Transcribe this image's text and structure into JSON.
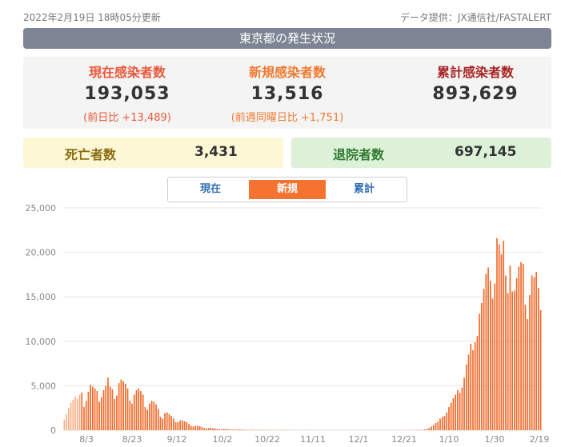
{
  "header": {
    "updated": "2022年2月19日 18時05分更新",
    "source": "データ提供：JX通信社/FASTALERT"
  },
  "title": "東京都の発生状況",
  "stats": {
    "current": {
      "label": "現在感染者数",
      "value": "193,053",
      "sub": "(前日比 +13,489)"
    },
    "new": {
      "label": "新規感染者数",
      "value": "13,516",
      "sub": "(前週同曜日比 +1,751)"
    },
    "total": {
      "label": "累計感染者数",
      "value": "893,629"
    },
    "deaths": {
      "label": "死亡者数",
      "value": "3,431"
    },
    "recovered": {
      "label": "退院者数",
      "value": "697,145"
    }
  },
  "tabs": [
    {
      "label": "現在",
      "active": false
    },
    {
      "label": "新規",
      "active": true
    },
    {
      "label": "累計",
      "active": false
    }
  ],
  "colors": {
    "bar": "#f06a2a",
    "bar_light": "#f7b08a",
    "title_bg": "#7d8493",
    "active_tab": "#f47330"
  },
  "chart_data": {
    "type": "bar",
    "ylim": [
      0,
      25000
    ],
    "yticks": [
      "0",
      "5,000",
      "10,000",
      "15,000",
      "20,000",
      "25,000"
    ],
    "xticks": [
      "8/3",
      "8/23",
      "9/12",
      "10/2",
      "10/22",
      "11/11",
      "12/1",
      "12/21",
      "1/10",
      "1/30",
      "2/19"
    ],
    "series": [
      {
        "values": [
          1200,
          1800,
          2500,
          3100,
          3400,
          3800,
          3500,
          4000,
          4200,
          2600,
          3300,
          4300,
          5100,
          4900,
          4700,
          4400,
          3200,
          3700,
          4500,
          5000,
          5900,
          4900,
          4600,
          3500,
          3900,
          5300,
          5700,
          5500,
          5200,
          4700,
          3300,
          3000,
          4000,
          4500,
          4700,
          4400,
          4000,
          2600,
          2300,
          3000,
          3300,
          3200,
          2900,
          2400,
          1500,
          1300,
          1900,
          2000,
          1800,
          1600,
          1300,
          900,
          900,
          1100,
          1100,
          1000,
          900,
          700,
          500,
          400,
          500,
          500,
          450,
          350,
          250,
          200,
          250,
          280,
          230,
          200,
          150,
          100,
          120,
          150,
          140,
          100,
          90,
          70,
          60,
          80,
          90,
          80,
          60,
          50,
          40,
          45,
          55,
          50,
          45,
          35,
          30,
          30,
          40,
          38,
          35,
          30,
          25,
          20,
          25,
          30,
          28,
          25,
          20,
          18,
          20,
          25,
          22,
          20,
          18,
          15,
          18,
          22,
          20,
          18,
          15,
          12,
          15,
          18,
          15,
          14,
          12,
          10,
          12,
          15,
          14,
          12,
          10,
          10,
          12,
          14,
          12,
          10,
          10,
          10,
          12,
          14,
          12,
          10,
          10,
          10,
          12,
          14,
          13,
          12,
          11,
          10,
          12,
          14,
          15,
          13,
          12,
          12,
          14,
          16,
          18,
          15,
          14,
          14,
          17,
          20,
          25,
          30,
          35,
          40,
          60,
          90,
          150,
          250,
          400,
          600,
          800,
          950,
          1300,
          1500,
          1600,
          2000,
          2600,
          3100,
          3600,
          4000,
          4500,
          4200,
          4800,
          5900,
          7400,
          8500,
          9700,
          9000,
          9900,
          10600,
          13100,
          14300,
          15900,
          17600,
          18300,
          16800,
          14800,
          16500,
          21600,
          20900,
          19800,
          21300,
          17400,
          15400,
          18500,
          15600,
          15700,
          17100,
          18400,
          18900,
          18700,
          14100,
          12500,
          15200,
          17400,
          17200,
          17800,
          16000,
          13500
        ]
      }
    ]
  }
}
